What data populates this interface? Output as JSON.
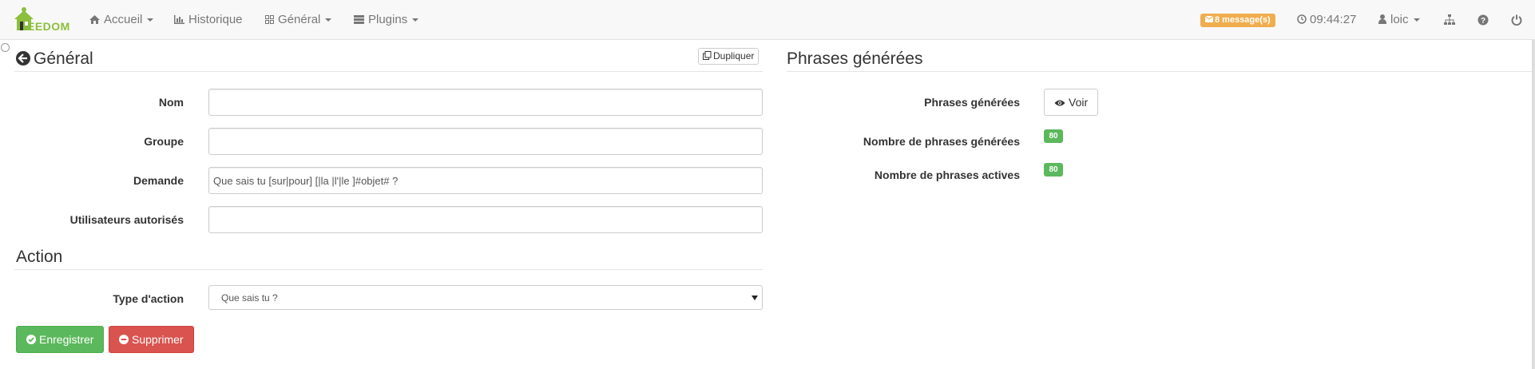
{
  "navbar": {
    "logo_text": "EEDOM",
    "items": [
      {
        "label": "Accueil",
        "icon": "home-icon"
      },
      {
        "label": "Historique",
        "icon": "bar-chart-icon"
      },
      {
        "label": "Général",
        "icon": "grid-icon"
      },
      {
        "label": "Plugins",
        "icon": "list-icon"
      }
    ],
    "messages_badge": "8 message(s)",
    "clock": "09:44:27",
    "user": "loic"
  },
  "left": {
    "title": "Général",
    "duplicate_label": "Dupliquer",
    "fields": {
      "nom": {
        "label": "Nom",
        "value": ""
      },
      "groupe": {
        "label": "Groupe",
        "value": ""
      },
      "demande": {
        "label": "Demande",
        "value": "Que sais tu [sur|pour] [|la |l'|le ]#objet# ?"
      },
      "utilisateurs": {
        "label": "Utilisateurs autorisés",
        "value": ""
      }
    },
    "action_title": "Action",
    "action_type": {
      "label": "Type d'action",
      "value": "Que sais tu ?"
    },
    "save_label": "Enregistrer",
    "delete_label": "Supprimer"
  },
  "right": {
    "title": "Phrases générées",
    "phrases_label": "Phrases générées",
    "voir_label": "Voir",
    "count_generated_label": "Nombre de phrases générées",
    "count_generated": "80",
    "count_active_label": "Nombre de phrases actives",
    "count_active": "80"
  },
  "colors": {
    "success": "#5cb85c",
    "danger": "#d9534f",
    "warning": "#f0ad4e",
    "brand": "#8bbf3c"
  }
}
